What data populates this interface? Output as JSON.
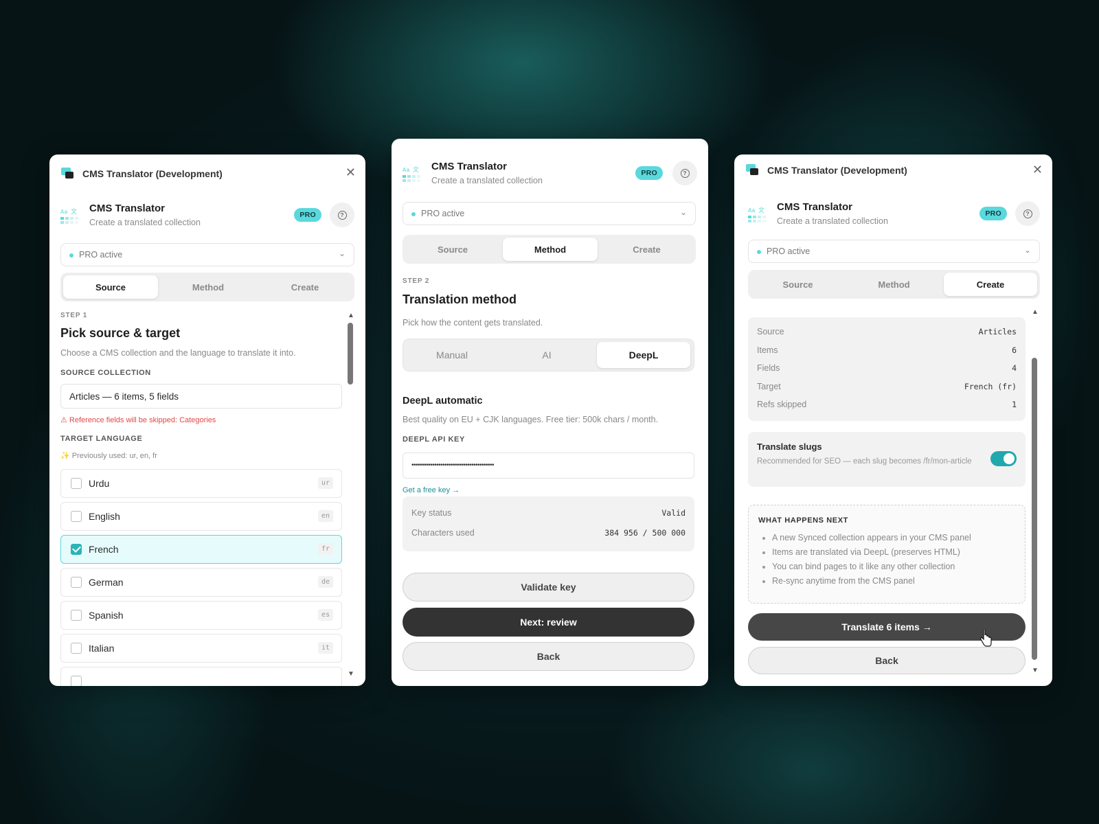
{
  "app": {
    "window_title": "CMS Translator (Development)",
    "name": "CMS Translator",
    "subtitle": "Create a translated collection",
    "pro_badge": "PRO",
    "status_label": "PRO active",
    "tabs": [
      "Source",
      "Method",
      "Create"
    ]
  },
  "panel1": {
    "step": "STEP 1",
    "heading": "Pick source & target",
    "description": "Choose a CMS collection and the language to translate it into.",
    "source_label": "SOURCE COLLECTION",
    "source_value": "Articles — 6 items, 5 fields",
    "warning": "⚠ Reference fields will be skipped: Categories",
    "target_label": "TARGET LANGUAGE",
    "previously_used": "✨ Previously used: ur, en, fr",
    "languages": [
      {
        "name": "Urdu",
        "code": "ur",
        "checked": false
      },
      {
        "name": "English",
        "code": "en",
        "checked": false
      },
      {
        "name": "French",
        "code": "fr",
        "checked": true
      },
      {
        "name": "German",
        "code": "de",
        "checked": false
      },
      {
        "name": "Spanish",
        "code": "es",
        "checked": false
      },
      {
        "name": "Italian",
        "code": "it",
        "checked": false
      }
    ]
  },
  "panel2": {
    "step": "STEP 2",
    "heading": "Translation method",
    "description": "Pick how the content gets translated.",
    "methods": [
      "Manual",
      "AI",
      "DeepL"
    ],
    "active_method": "DeepL",
    "method_title": "DeepL automatic",
    "method_desc": "Best quality on EU + CJK languages. Free tier: 500k chars / month.",
    "api_key_label": "DEEPL API KEY",
    "api_key_value": "••••••••••••••••••••••••••••••••••••••••",
    "free_key_link": "Get a free key →",
    "key_status_label": "Key status",
    "key_status_value": "Valid",
    "chars_used_label": "Characters used",
    "chars_used_value": "384 956 / 500 000",
    "validate_button": "Validate key",
    "next_button": "Next: review",
    "back_button": "Back"
  },
  "panel3": {
    "summary": [
      {
        "label": "Source",
        "value": "Articles"
      },
      {
        "label": "Items",
        "value": "6"
      },
      {
        "label": "Fields",
        "value": "4"
      },
      {
        "label": "Target",
        "value": "French (fr)"
      },
      {
        "label": "Refs skipped",
        "value": "1"
      }
    ],
    "slugs_title": "Translate slugs",
    "slugs_desc": "Recommended for SEO — each slug becomes /fr/mon-article",
    "slugs_enabled": true,
    "next_title": "WHAT HAPPENS NEXT",
    "next_items": [
      "A new Synced collection appears in your CMS panel",
      "Items are translated via DeepL (preserves HTML)",
      "You can bind pages to it like any other collection",
      "Re-sync anytime from the CMS panel"
    ],
    "translate_button": "Translate 6 items →",
    "back_button": "Back"
  },
  "colors": {
    "accent": "#5ad8dc",
    "toggle_on": "#20a8ad",
    "warning": "#e04848",
    "dark_button": "#333333"
  }
}
